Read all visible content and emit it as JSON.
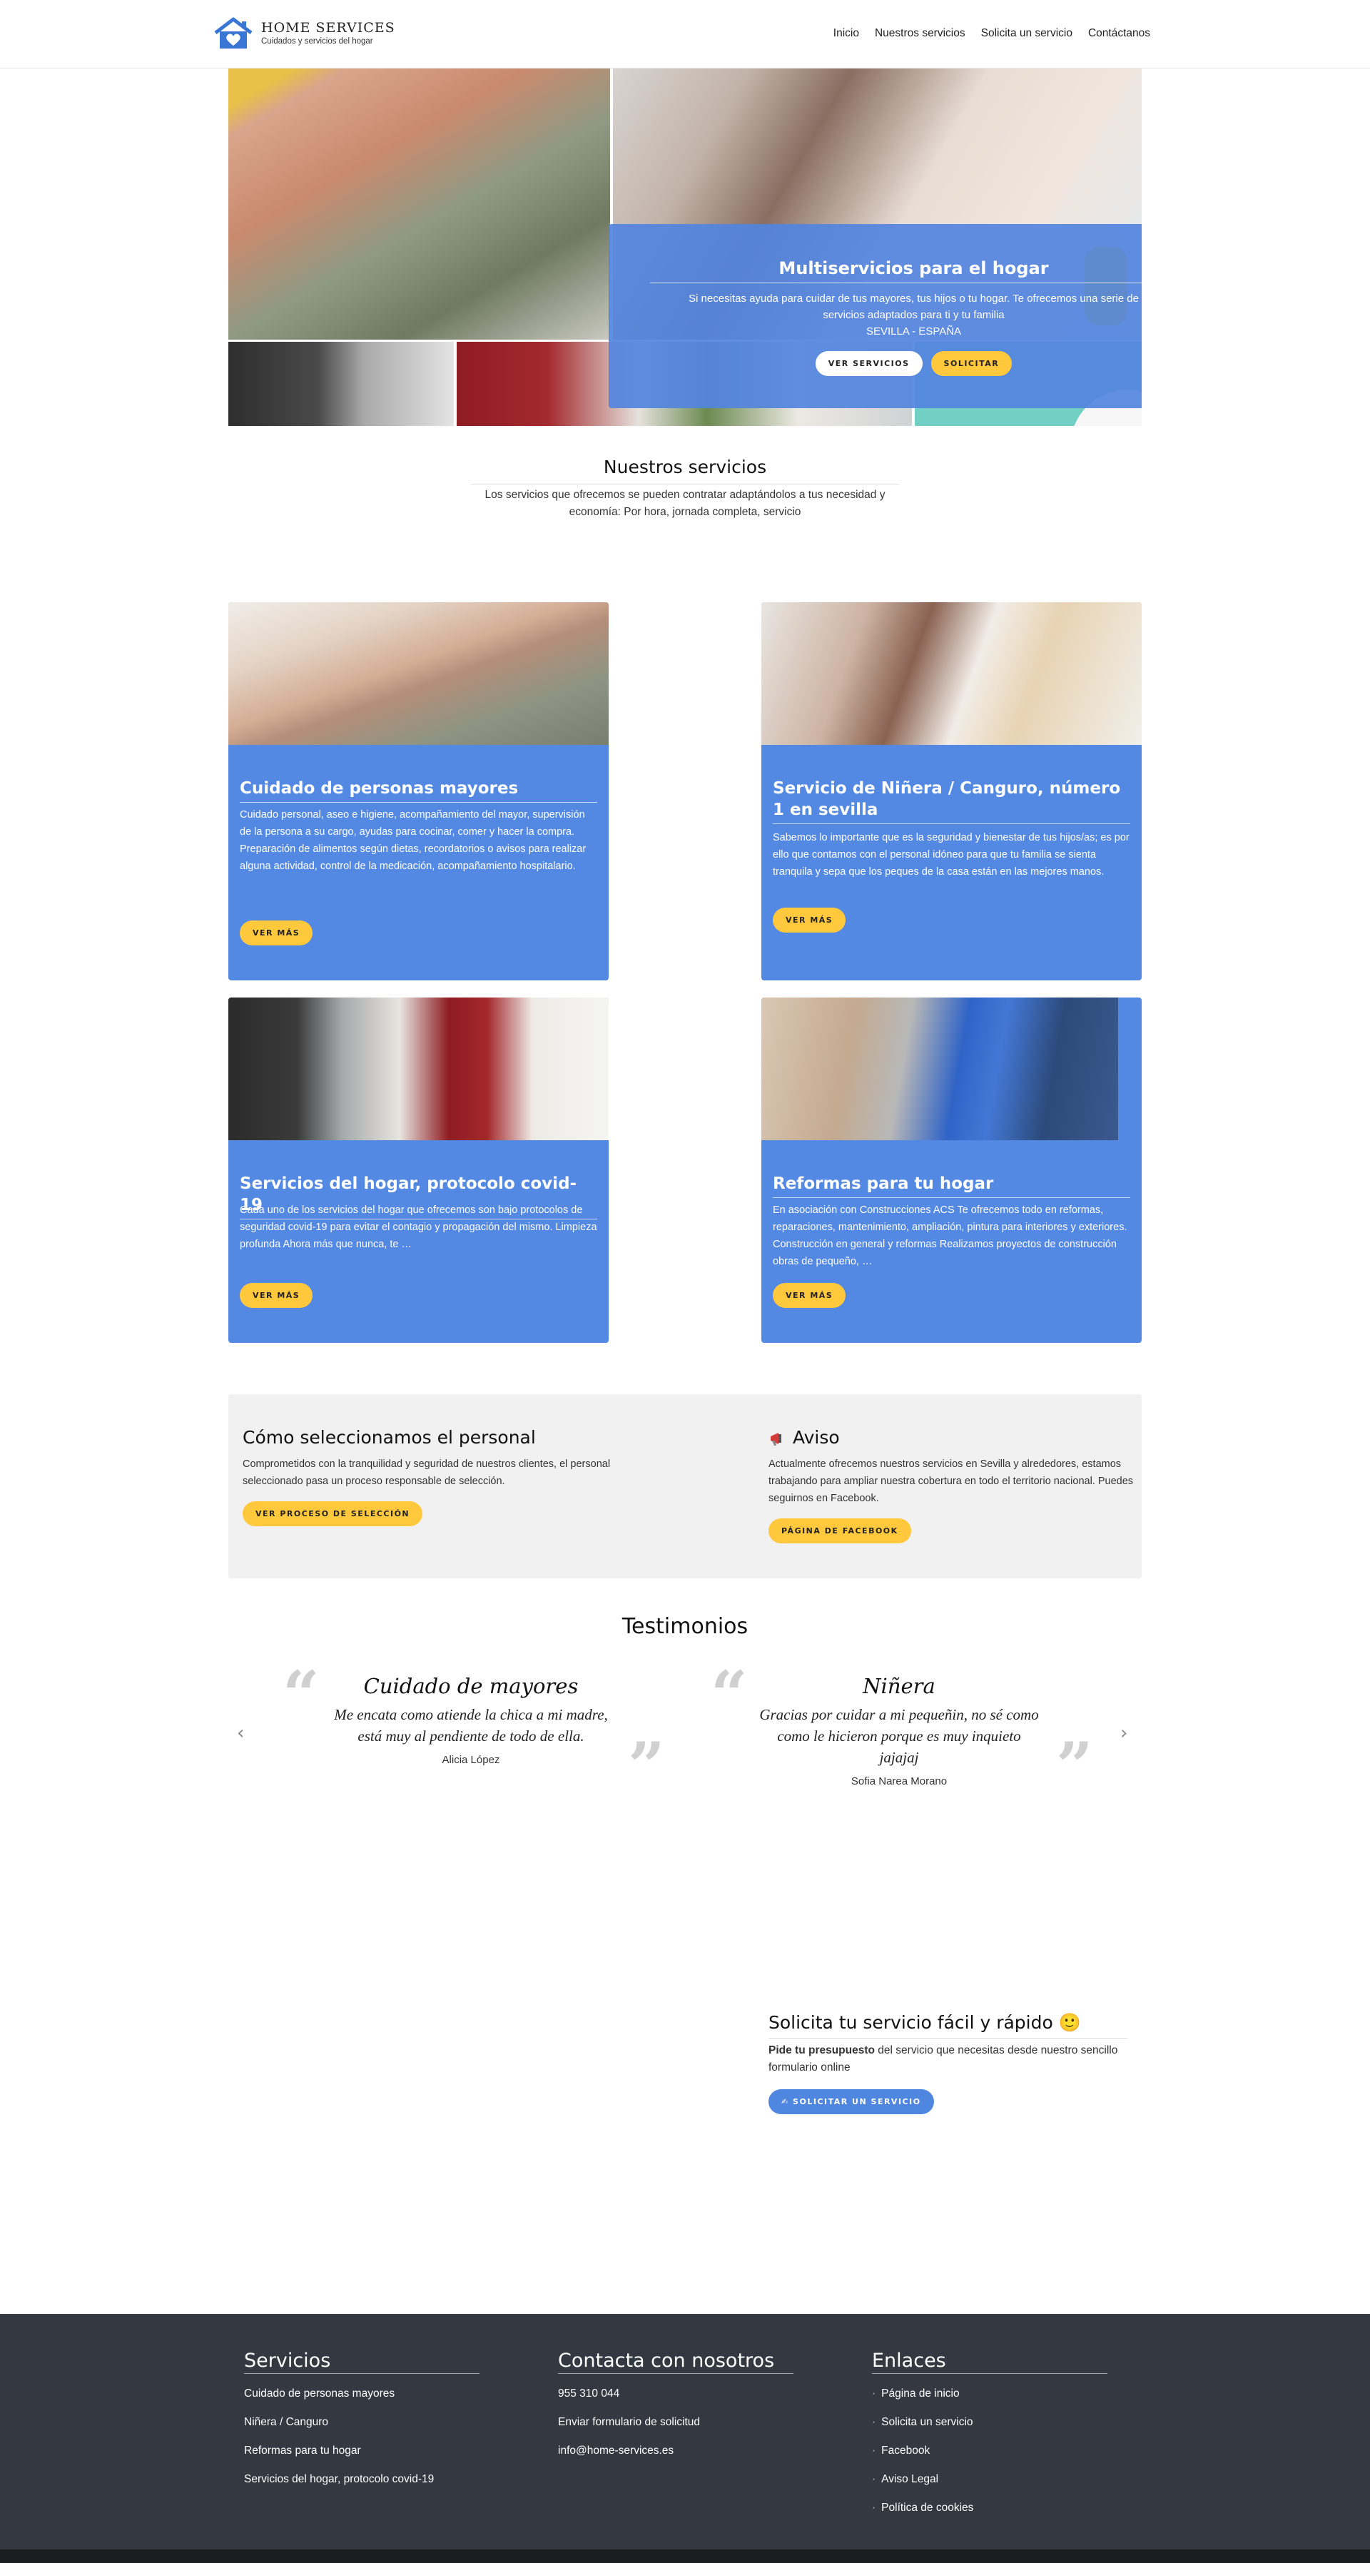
{
  "header": {
    "logo_title": "HOME SERVICES",
    "logo_subtitle": "Cuidados y servicios del hogar",
    "nav": [
      "Inicio",
      "Nuestros servicios",
      "Solicita un servicio",
      "Contáctanos"
    ]
  },
  "hero": {
    "title": "Multiservicios para el hogar",
    "text": "Si necesitas ayuda para cuidar de tus mayores, tus hijos o tu hogar. Te ofrecemos una serie de servicios adaptados para ti y tu familia",
    "location": "SEVILLA - ESPAÑA",
    "btn_services": "VER SERVICIOS",
    "btn_request": "SOLICITAR"
  },
  "services": {
    "title": "Nuestros servicios",
    "subtitle": "Los servicios que ofrecemos se pueden contratar adaptándolos a tus necesidad y economía: Por hora, jornada completa, servicio",
    "cards": [
      {
        "title": "Cuidado de personas mayores",
        "text": "Cuidado personal, aseo e higiene, acompañamiento del mayor, supervisión de la persona a su cargo, ayudas para cocinar, comer y hacer la compra.\nPreparación de alimentos según dietas, recordatorios o avisos para realizar alguna actividad, control de la medicación, acompañamiento hospitalario.",
        "button": "VER MÁS"
      },
      {
        "title": "Servicio de Niñera / Canguro, número 1 en sevilla",
        "text": "Sabemos lo importante que es la seguridad y bienestar de tus hijos/as; es por ello que contamos con el personal idóneo para que tu familia se sienta tranquila y sepa que los peques de la casa están en las mejores manos.",
        "button": "VER MÁS"
      },
      {
        "title": "Servicios del hogar, protocolo covid-19",
        "text": "Cada uno de los servicios del hogar que ofrecemos son bajo protocolos de seguridad covid-19 para evitar el contagio y propagación del mismo. Limpieza profunda Ahora más que nunca, te …",
        "button": "VER MÁS"
      },
      {
        "title": "Reformas para tu hogar",
        "text": "En asociación con Construcciones ACS Te ofrecemos todo en reformas, reparaciones, mantenimiento, ampliación, pintura para interiores y exteriores. Construcción en general y reformas Realizamos proyectos de construcción obras de pequeño, …",
        "button": "VER MÁS"
      }
    ]
  },
  "selection": {
    "title": "Cómo seleccionamos el personal",
    "text": "Comprometidos con la tranquilidad y seguridad de nuestros clientes, el personal seleccionado pasa un proceso responsable de selección.",
    "button": "VER PROCESO DE SELECCIÓN"
  },
  "notice": {
    "title": "Aviso",
    "text": "Actualmente ofrecemos nuestros servicios en Sevilla y alrededores, estamos trabajando para ampliar nuestra cobertura en todo el territorio nacional. Puedes seguirnos en Facebook.",
    "button": "PÁGINA DE FACEBOOK"
  },
  "testimonials": {
    "title": "Testimonios",
    "items": [
      {
        "title": "Cuidado de mayores",
        "quote": "Me encata como atiende la chica a mi madre, está muy al pendiente de todo de ella.",
        "author": "Alicia López"
      },
      {
        "title": "Niñera",
        "quote": "Gracias por cuidar a mi pequeñin, no sé como como le hicieron porque es muy inquieto jajajaj",
        "author": "Sofia Narea Morano"
      }
    ],
    "prev": "‹",
    "next": "›"
  },
  "request": {
    "title": "Solicita tu servicio fácil y rápido 🙂",
    "text_bold": "Pide tu presupuesto",
    "text": " del servicio que necesitas desde nuestro sencillo formulario online",
    "button": "✍ SOLICITAR UN SERVICIO"
  },
  "footer": {
    "services_title": "Servicios",
    "services": [
      "Cuidado de personas mayores",
      "Niñera / Canguro",
      "Reformas para tu hogar",
      "Servicios del hogar, protocolo covid-19"
    ],
    "contact_title": "Contacta con nosotros",
    "contact": [
      "955 310 044",
      "Enviar formulario de solicitud",
      "info@home-services.es"
    ],
    "links_title": "Enlaces",
    "links": [
      "Página de inicio",
      "Solicita un servicio",
      "Facebook",
      "Aviso Legal",
      "Política de cookies"
    ]
  },
  "colors": {
    "brand_blue": "#5388e3",
    "yellow": "#ffc83d",
    "footer_bg": "#343841"
  }
}
